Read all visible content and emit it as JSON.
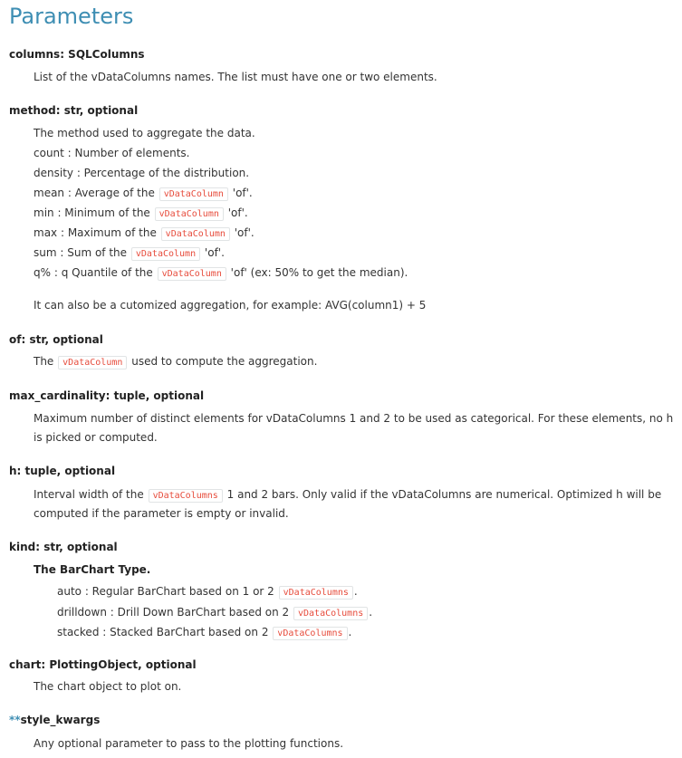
{
  "title": "Parameters",
  "code_color": "#e74c3c",
  "accent_color": "#3e8eb3",
  "params": {
    "columns": {
      "term": "columns: SQLColumns",
      "desc": "List of the vDataColumns names. The list must have one or two elements."
    },
    "method": {
      "term": "method: str, optional",
      "intro": "The method used to aggregate the data.",
      "count": "count : Number of elements.",
      "density": "density : Percentage of the distribution.",
      "mean_pre": "mean : Average of the",
      "mean_code": "vDataColumn",
      "mean_post": "'of'.",
      "min_pre": "min : Minimum of the",
      "min_code": "vDataColumn",
      "min_post": "'of'.",
      "max_pre": "max : Maximum of the",
      "max_code": "vDataColumn",
      "max_post": "'of'.",
      "sum_pre": "sum : Sum of the",
      "sum_code": "vDataColumn",
      "sum_post": "'of'.",
      "q_pre": "q% : q Quantile of the",
      "q_code": "vDataColumn",
      "q_post": "'of' (ex: 50% to get the median).",
      "custom": "It can also be a cutomized aggregation, for example: AVG(column1) + 5"
    },
    "of": {
      "term": "of: str, optional",
      "pre": "The",
      "code": "vDataColumn",
      "post": "used to compute the aggregation."
    },
    "max_cardinality": {
      "term": "max_cardinality: tuple, optional",
      "line1": "Maximum number of distinct elements for vDataColumns 1 and 2 to be used as categorical. For these elements, no h",
      "line2": "is picked or computed."
    },
    "h": {
      "term": "h: tuple, optional",
      "pre": "Interval width of the",
      "code": "vDataColumns",
      "post": "1 and 2 bars. Only valid if the vDataColumns are numerical. Optimized h will be",
      "line2": "computed if the parameter is empty or invalid."
    },
    "kind": {
      "term": "kind: str, optional",
      "subtitle": "The BarChart Type.",
      "auto_pre": "auto : Regular BarChart based on 1 or 2",
      "auto_code": "vDataColumns",
      "auto_post": ".",
      "drill_pre": "drilldown : Drill Down BarChart based on 2",
      "drill_code": "vDataColumns",
      "drill_post": ".",
      "stacked_pre": "stacked : Stacked BarChart based on 2",
      "stacked_code": "vDataColumns",
      "stacked_post": "."
    },
    "chart": {
      "term": "chart: PlottingObject, optional",
      "desc": "The chart object to plot on."
    },
    "style_kwargs": {
      "stars": "**",
      "term": "style_kwargs",
      "desc": "Any optional parameter to pass to the plotting functions."
    }
  }
}
